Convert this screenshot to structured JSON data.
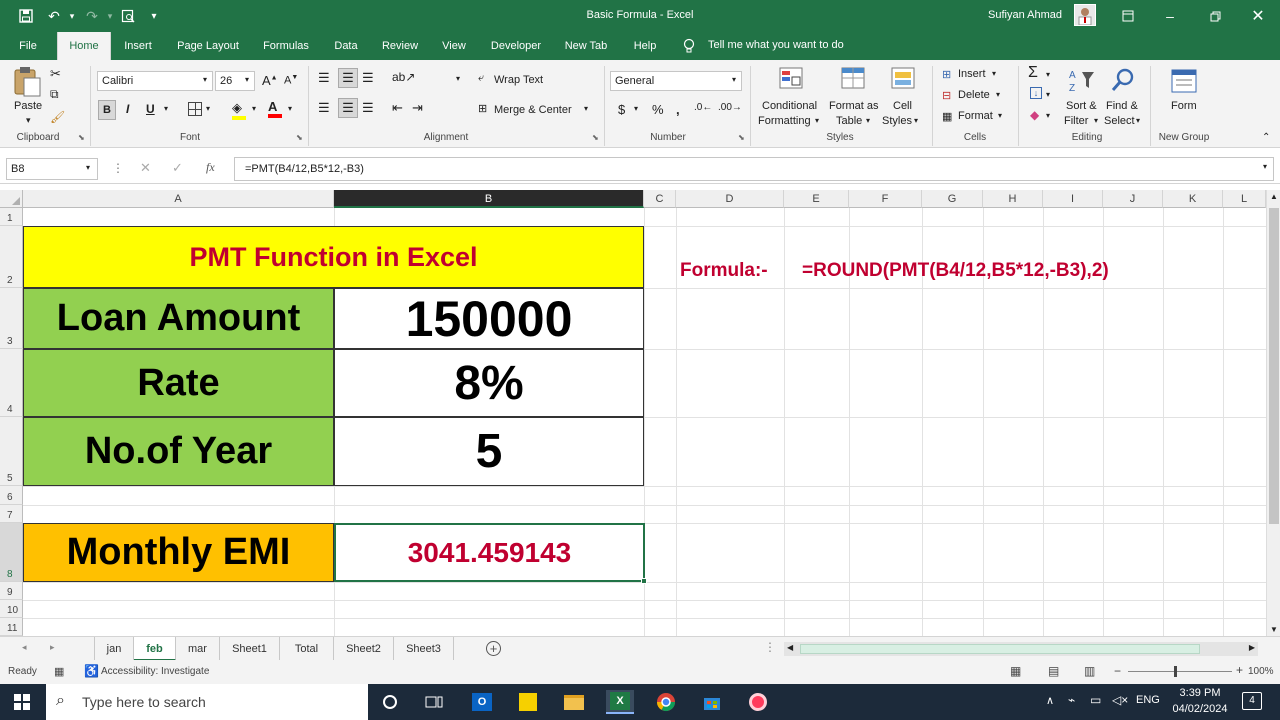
{
  "titlebar": {
    "doc_title": "Basic Formula - Excel",
    "user_name": "Sufiyan Ahmad"
  },
  "ribbon_tabs": [
    "File",
    "Home",
    "Insert",
    "Page Layout",
    "Formulas",
    "Data",
    "Review",
    "View",
    "Developer",
    "New Tab",
    "Help"
  ],
  "tell_me": "Tell me what you want to do",
  "ribbon": {
    "paste": "Paste",
    "font_name": "Calibri",
    "font_size": "26",
    "wrap_text": "Wrap Text",
    "merge_center": "Merge & Center",
    "number_format": "General",
    "conditional_formatting_1": "Conditional",
    "conditional_formatting_2": "Formatting",
    "format_as_table_1": "Format as",
    "format_as_table_2": "Table",
    "cell_styles_1": "Cell",
    "cell_styles_2": "Styles",
    "insert": "Insert",
    "delete": "Delete",
    "format": "Format",
    "sort_filter_1": "Sort &",
    "sort_filter_2": "Filter",
    "find_select_1": "Find &",
    "find_select_2": "Select",
    "form": "Form",
    "groups": {
      "clipboard": "Clipboard",
      "font": "Font",
      "alignment": "Alignment",
      "number": "Number",
      "styles": "Styles",
      "cells": "Cells",
      "editing": "Editing",
      "new_group": "New Group"
    }
  },
  "formula_bar": {
    "name_box": "B8",
    "formula": "=PMT(B4/12,B5*12,-B3)"
  },
  "columns": [
    "A",
    "B",
    "C",
    "D",
    "E",
    "F",
    "G",
    "H",
    "I",
    "J",
    "K",
    "L"
  ],
  "rows": [
    "1",
    "2",
    "3",
    "4",
    "5",
    "6",
    "7",
    "8",
    "9",
    "10",
    "11"
  ],
  "cells": {
    "title": "PMT Function in Excel",
    "loan_label": "Loan Amount",
    "loan_value": "150000",
    "rate_label": "Rate",
    "rate_value": "8%",
    "years_label": "No.of Year",
    "years_value": "5",
    "emi_label": "Monthly EMI",
    "emi_value": "3041.459143",
    "formula_note_label": "Formula:-",
    "formula_note_value": "=ROUND(PMT(B4/12,B5*12,-B3),2)"
  },
  "sheet_tabs": [
    "jan",
    "feb",
    "mar",
    "Sheet1",
    "Total",
    "Sheet2",
    "Sheet3"
  ],
  "active_sheet": "feb",
  "status": {
    "ready": "Ready",
    "accessibility": "Accessibility: Investigate",
    "zoom": "100%"
  },
  "taskbar": {
    "search_placeholder": "Type here to search",
    "lang": "ENG",
    "time": "3:39 PM",
    "date": "04/02/2024",
    "notifications": "4"
  },
  "colors": {
    "excel_green": "#217346",
    "title_fill": "#ffff00",
    "label_fill": "#92d050",
    "emi_fill": "#ffc000",
    "accent_red": "#c00030"
  }
}
